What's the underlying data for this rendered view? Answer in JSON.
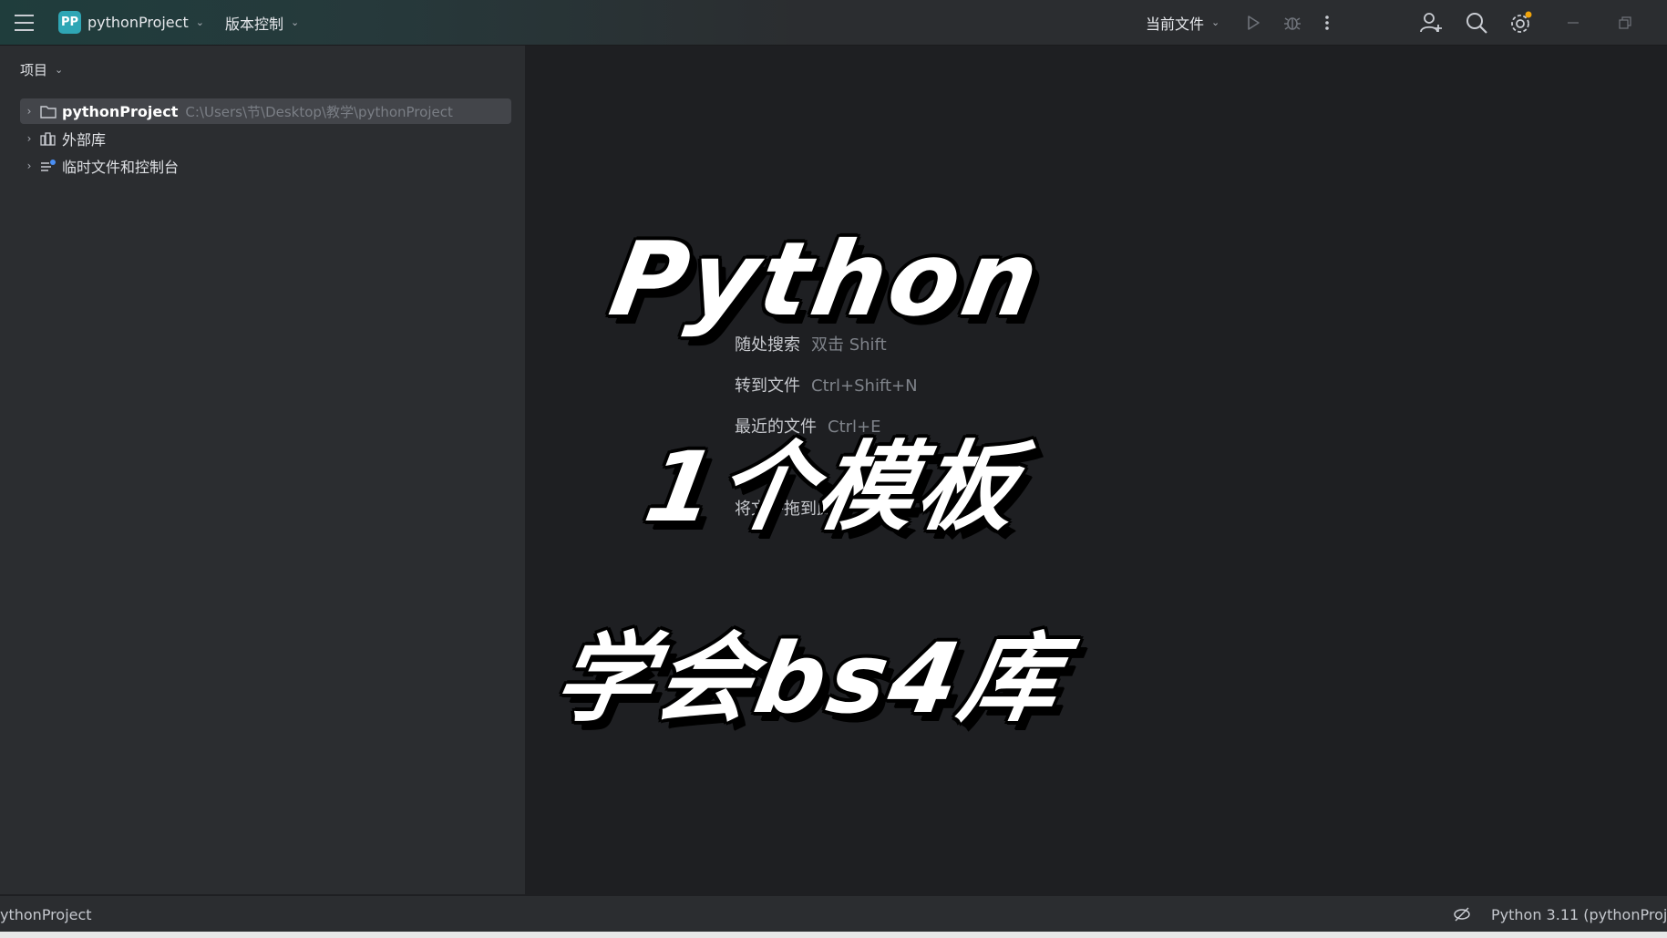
{
  "titlebar": {
    "project_badge": "PP",
    "project_name": "pythonProject",
    "vcs_label": "版本控制",
    "run_config": "当前文件",
    "accent_color": "#2fa6b5",
    "notification_dot_color": "#f0a30a"
  },
  "project_panel": {
    "header": "项目",
    "tree": [
      {
        "label": "pythonProject",
        "path": "C:\\Users\\节\\Desktop\\教学\\pythonProject",
        "icon": "folder-icon",
        "selected": true
      },
      {
        "label": "外部库",
        "icon": "library-icon"
      },
      {
        "label": "临时文件和控制台",
        "icon": "scratch-icon"
      }
    ]
  },
  "editor": {
    "hints": [
      {
        "label": "随处搜索",
        "key": "双击 Shift"
      },
      {
        "label": "转到文件",
        "key": "Ctrl+Shift+N"
      },
      {
        "label": "最近的文件",
        "key": "Ctrl+E"
      },
      {
        "label": "将文件拖到此处",
        "key": ""
      }
    ],
    "overlay": {
      "line1": "Python",
      "line2": "1个模板",
      "line3": "学会bs4库"
    }
  },
  "statusbar": {
    "left": "ythonProject",
    "interpreter": "Python 3.11 (pythonProje"
  }
}
